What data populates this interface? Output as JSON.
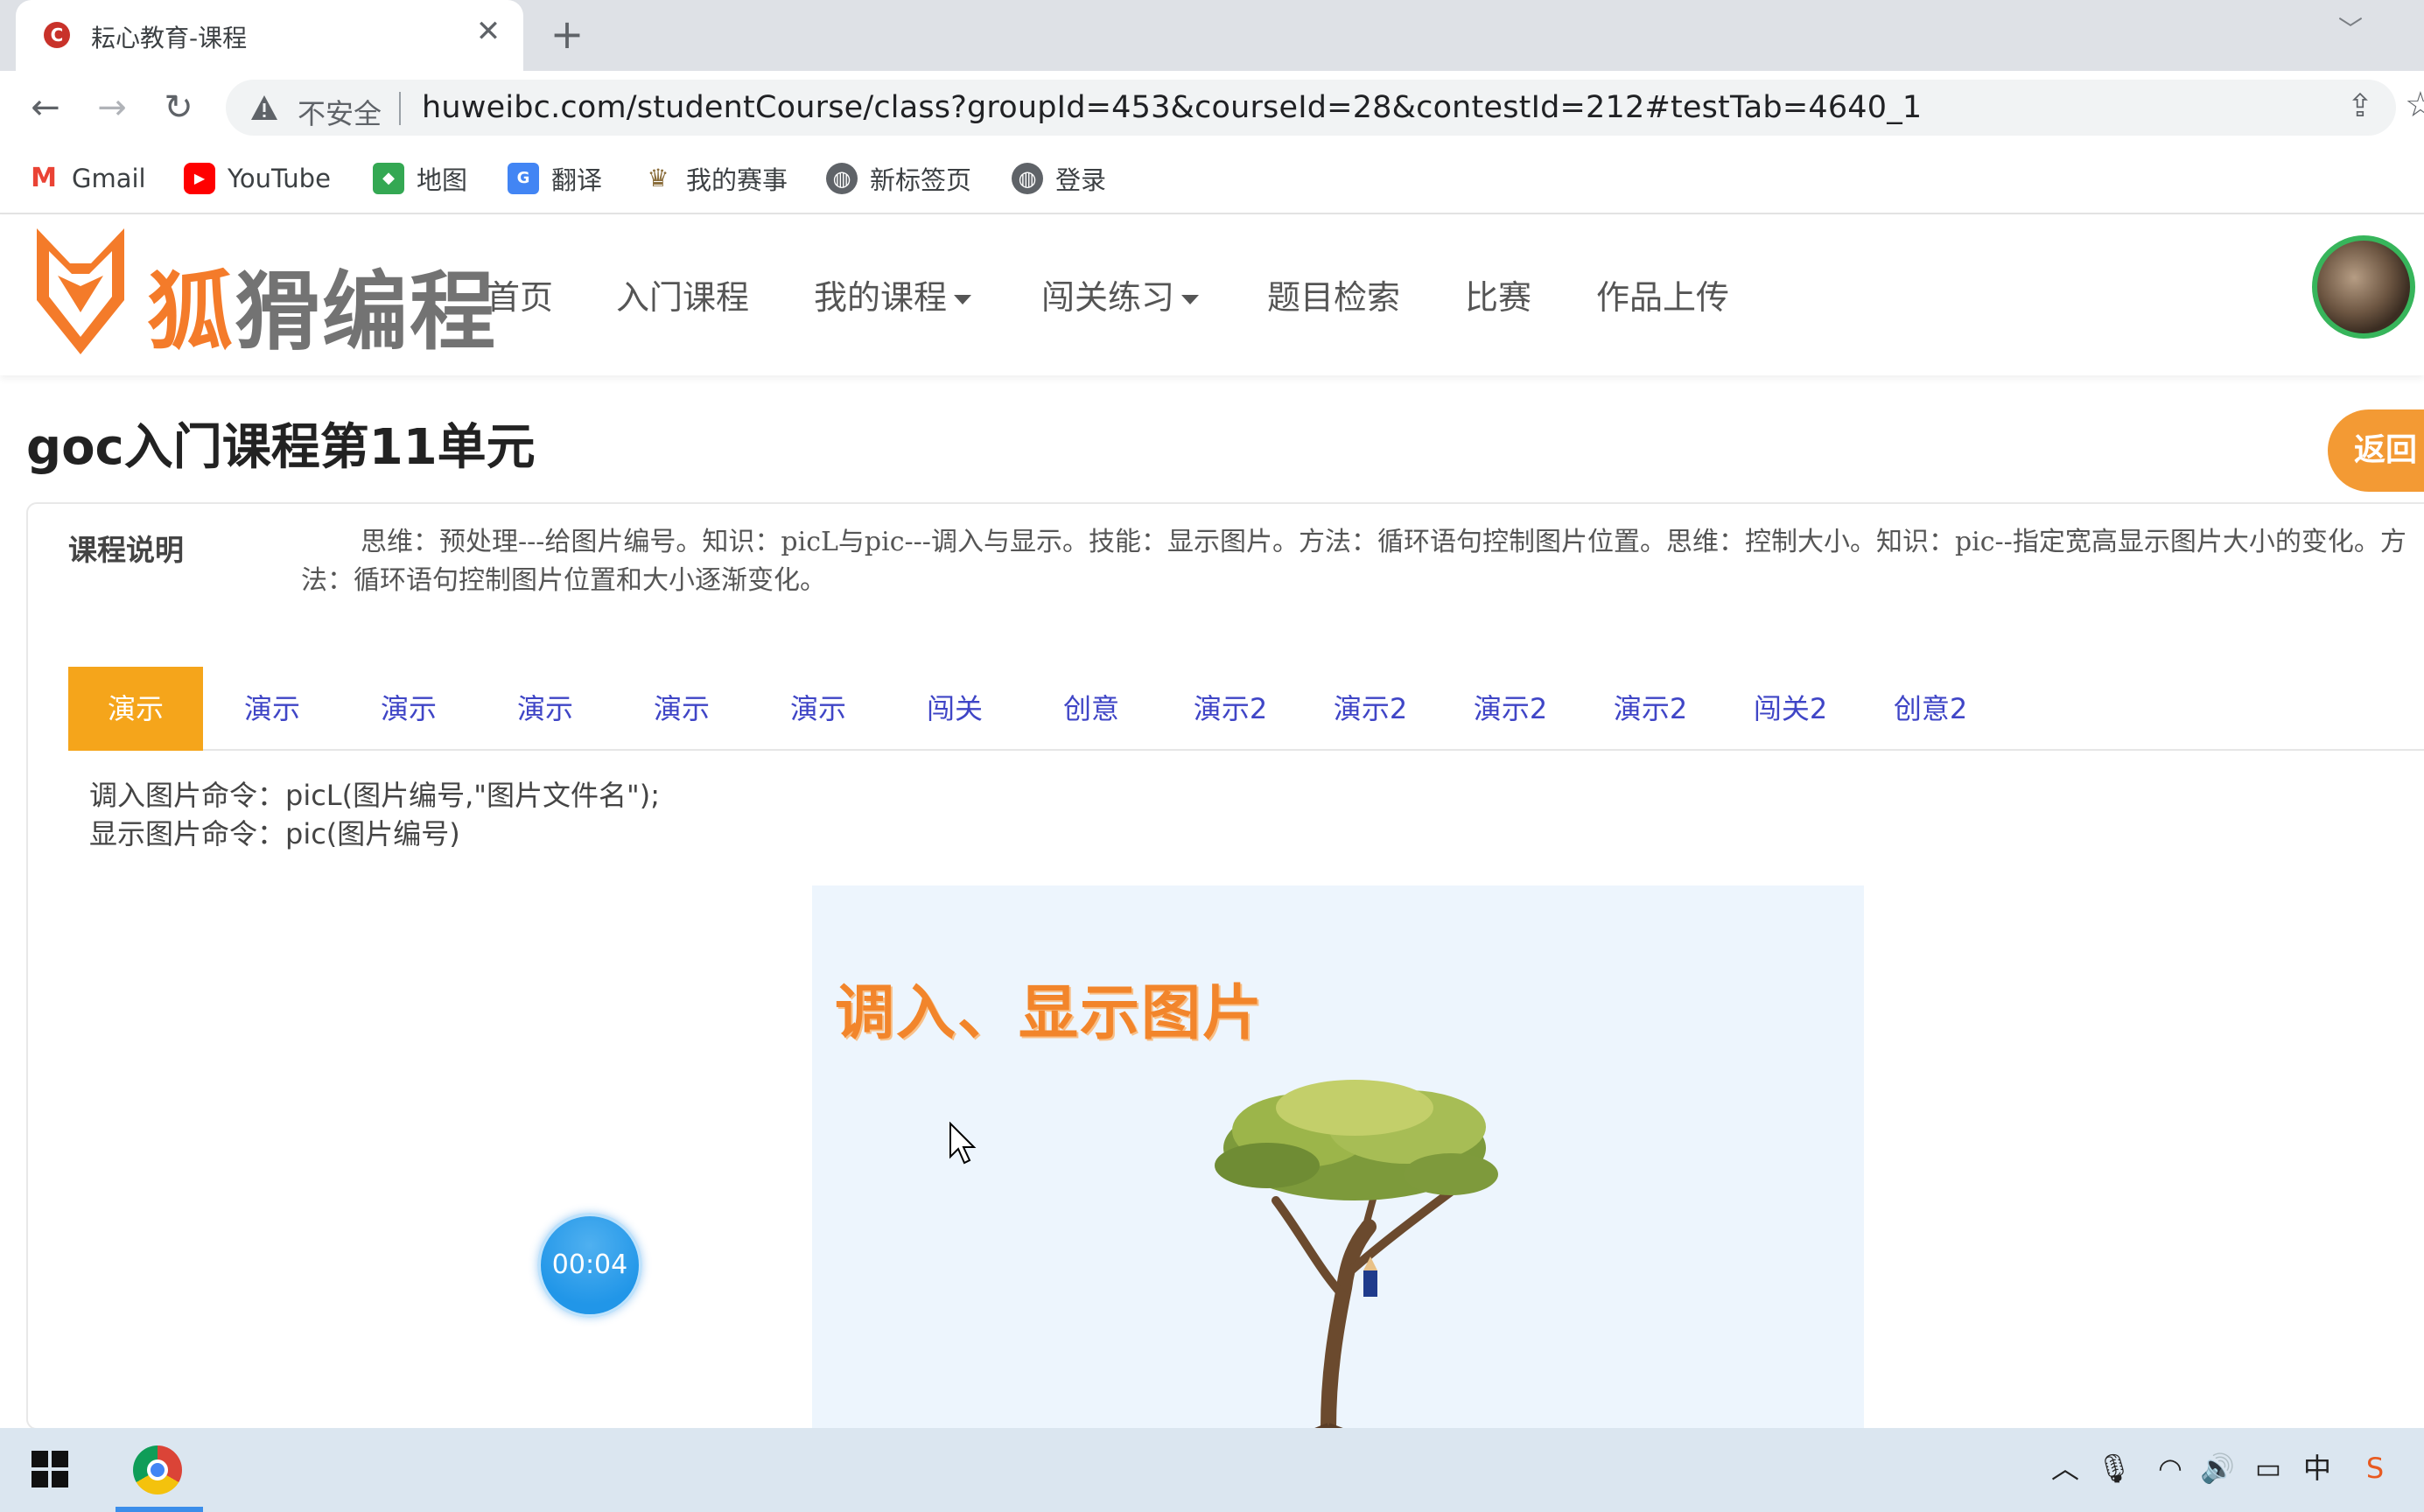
{
  "browser": {
    "tab_title": "耘心教育-课程",
    "tab_favicon": "C",
    "tab_close": "✕",
    "new_tab": "+",
    "security_label": "不安全",
    "url": "huweibc.com/studentCourse/class?groupId=453&courseId=28&contestId=212#testTab=4640_1"
  },
  "bookmarks": [
    {
      "label": "Gmail",
      "icon": "gmail-icon",
      "color": "#ea4335"
    },
    {
      "label": "YouTube",
      "icon": "youtube-icon",
      "color": "#ff0000"
    },
    {
      "label": "地图",
      "icon": "maps-icon",
      "color": "#34a853"
    },
    {
      "label": "翻译",
      "icon": "translate-icon",
      "color": "#4285f4"
    },
    {
      "label": "我的赛事",
      "icon": "trophy-icon",
      "color": "#8a6d3b"
    },
    {
      "label": "新标签页",
      "icon": "globe-icon",
      "color": "#5f6368"
    },
    {
      "label": "登录",
      "icon": "globe-icon",
      "color": "#5f6368"
    }
  ],
  "site": {
    "logo_text_a": "狐",
    "logo_text_b": "猾编程",
    "nav": [
      "首页",
      "入门课程",
      "我的课程",
      "闯关练习",
      "题目检索",
      "比赛",
      "作品上传"
    ]
  },
  "page": {
    "title": "goc入门课程第11单元",
    "return_label": "返回"
  },
  "course": {
    "desc_label": "课程说明",
    "desc_text": "思维：预处理---给图片编号。知识：picL与pic---调入与显示。技能：显示图片。方法：循环语句控制图片位置。思维：控制大小。知识：pic--指定宽高显示图片大小的变化。方法：循环语句控制图片位置和大小逐渐变化。",
    "tabs": [
      "演示",
      "演示",
      "演示",
      "演示",
      "演示",
      "演示",
      "闯关",
      "创意",
      "演示2",
      "演示2",
      "演示2",
      "演示2",
      "闯关2",
      "创意2"
    ],
    "active_tab": 0,
    "cmd1": "调入图片命令：picL(图片编号,\"图片文件名\");",
    "cmd2": "显示图片命令：pic(图片编号)",
    "video_title": "调入、显示图片",
    "timer": "00:04"
  },
  "colors": {
    "accent": "#f5a51b",
    "tab_link": "#3f45c6",
    "brand_orange": "#f47b2a"
  },
  "taskbar": {
    "ime": "中"
  }
}
